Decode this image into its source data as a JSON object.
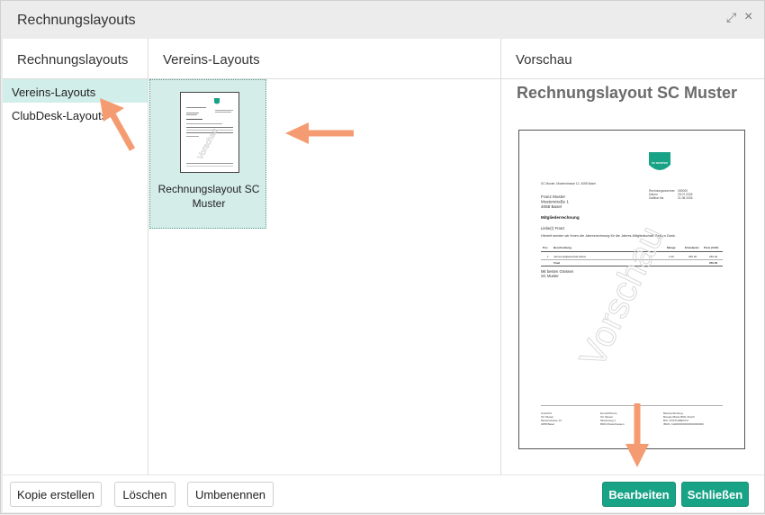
{
  "dialog": {
    "title": "Rechnungslayouts",
    "expand_glyph": "⤢",
    "close_glyph": "×"
  },
  "panels": {
    "left": {
      "header": "Rechnungslayouts",
      "items": [
        {
          "label": "Vereins-Layouts",
          "selected": true
        },
        {
          "label": "ClubDesk-Layouts",
          "selected": false
        }
      ]
    },
    "middle": {
      "header": "Vereins-Layouts",
      "tiles": [
        {
          "label": "Rechnungslayout SC Muster",
          "watermark": "Vorschau"
        }
      ]
    },
    "right": {
      "header": "Vorschau",
      "title": "Rechnungslayout SC Muster",
      "watermark": "Vorschau"
    }
  },
  "invoice": {
    "logo_text": "SC MUSTER",
    "sender_line": "SC Muster, Musterstrasse 12, 4058 Basel",
    "meta_labels": "Rechnungsnummer\nDatum\nZahlbar bis",
    "meta_values": "000000\n25.07.2026\n21.08.2026",
    "recipient": "Franz Muster\nMusterstraße 1\n4058 Basel",
    "heading": "Mitgliederrechnung",
    "greeting": "Liebe(r) Franz",
    "intro": "Hiermit senden wir Ihnen die Jahresrechnung für die Jahres-Mitgliedschaft. Besten Dank.",
    "table_header": [
      "Pos",
      "Beschreibung",
      "Menge",
      "Einzelpreis",
      "Preis (CHF)"
    ],
    "table_row": [
      "1",
      "Jahresmitgliedschaft Aktive",
      "1.00",
      "250.00",
      "250.00"
    ],
    "total_label": "Total",
    "total_value": "250.00",
    "closing": "Mit besten Grüssen\nSC Muster",
    "footer_cols": [
      "Anschrift\nSC Muster\nMusterstrasse 12\n4058 Basel",
      "Domizil/Konto\nSC Muster\nMusterweg 1\n8000 Musterhausen",
      "Bankverbindung\nBeispiel Bank 8001 Zürich\nBIC: POFICHBEXXX\nIBAN: CH0000000000000000000"
    ]
  },
  "footer": {
    "copy_label": "Kopie erstellen",
    "delete_label": "Löschen",
    "rename_label": "Umbenennen",
    "edit_label": "Bearbeiten",
    "close_label": "Schließen"
  },
  "colors": {
    "accent": "#19a386",
    "selection": "#d2eeea",
    "annotation_arrow": "#f59b72"
  }
}
